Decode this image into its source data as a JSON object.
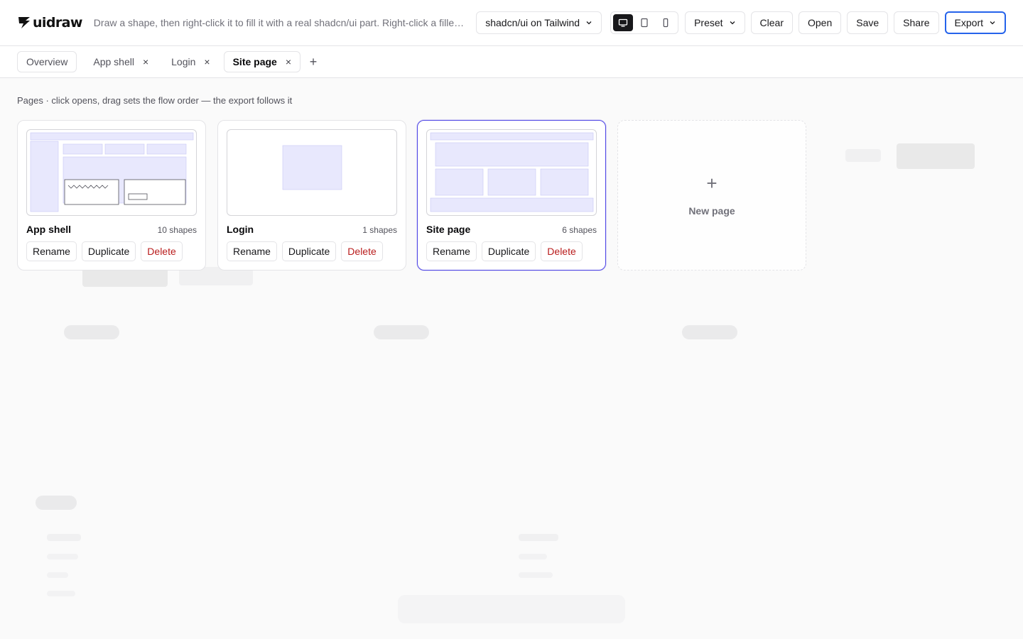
{
  "header": {
    "logo_text": "uidraw",
    "tagline": "Draw a shape, then right-click it to fill it with a real shadcn/ui part. Right-click a filled page to edit it.",
    "stack_select": "shadcn/ui on Tailwind",
    "devices": [
      {
        "icon": "desktop-icon",
        "active": true
      },
      {
        "icon": "tablet-icon",
        "active": false
      },
      {
        "icon": "phone-icon",
        "active": false
      }
    ],
    "preset_label": "Preset",
    "clear_label": "Clear",
    "open_label": "Open",
    "save_label": "Save",
    "share_label": "Share",
    "export_label": "Export",
    "accent": "#2563eb"
  },
  "tabs": {
    "overview_label": "Overview",
    "items": [
      {
        "label": "App shell",
        "close": "×",
        "active": false
      },
      {
        "label": "Login",
        "close": "×",
        "active": false
      },
      {
        "label": "Site page",
        "close": "×",
        "active": true
      }
    ],
    "add_label": "+"
  },
  "overview": {
    "hint": "Pages · click opens, drag sets the flow order — the export follows it",
    "pages": [
      {
        "name": "App shell",
        "count": "10 shapes",
        "selected": false
      },
      {
        "name": "Login",
        "count": "1 shapes",
        "selected": false
      },
      {
        "name": "Site page",
        "count": "6 shapes",
        "selected": true
      }
    ],
    "actions": {
      "rename": "Rename",
      "duplicate": "Duplicate",
      "delete": "Delete"
    },
    "new_page_icon": "+",
    "new_page_label": "New page",
    "selected_color": "#4f46e5",
    "delete_color": "#b91c1c",
    "thumb_fill": "#e8e8fd"
  }
}
